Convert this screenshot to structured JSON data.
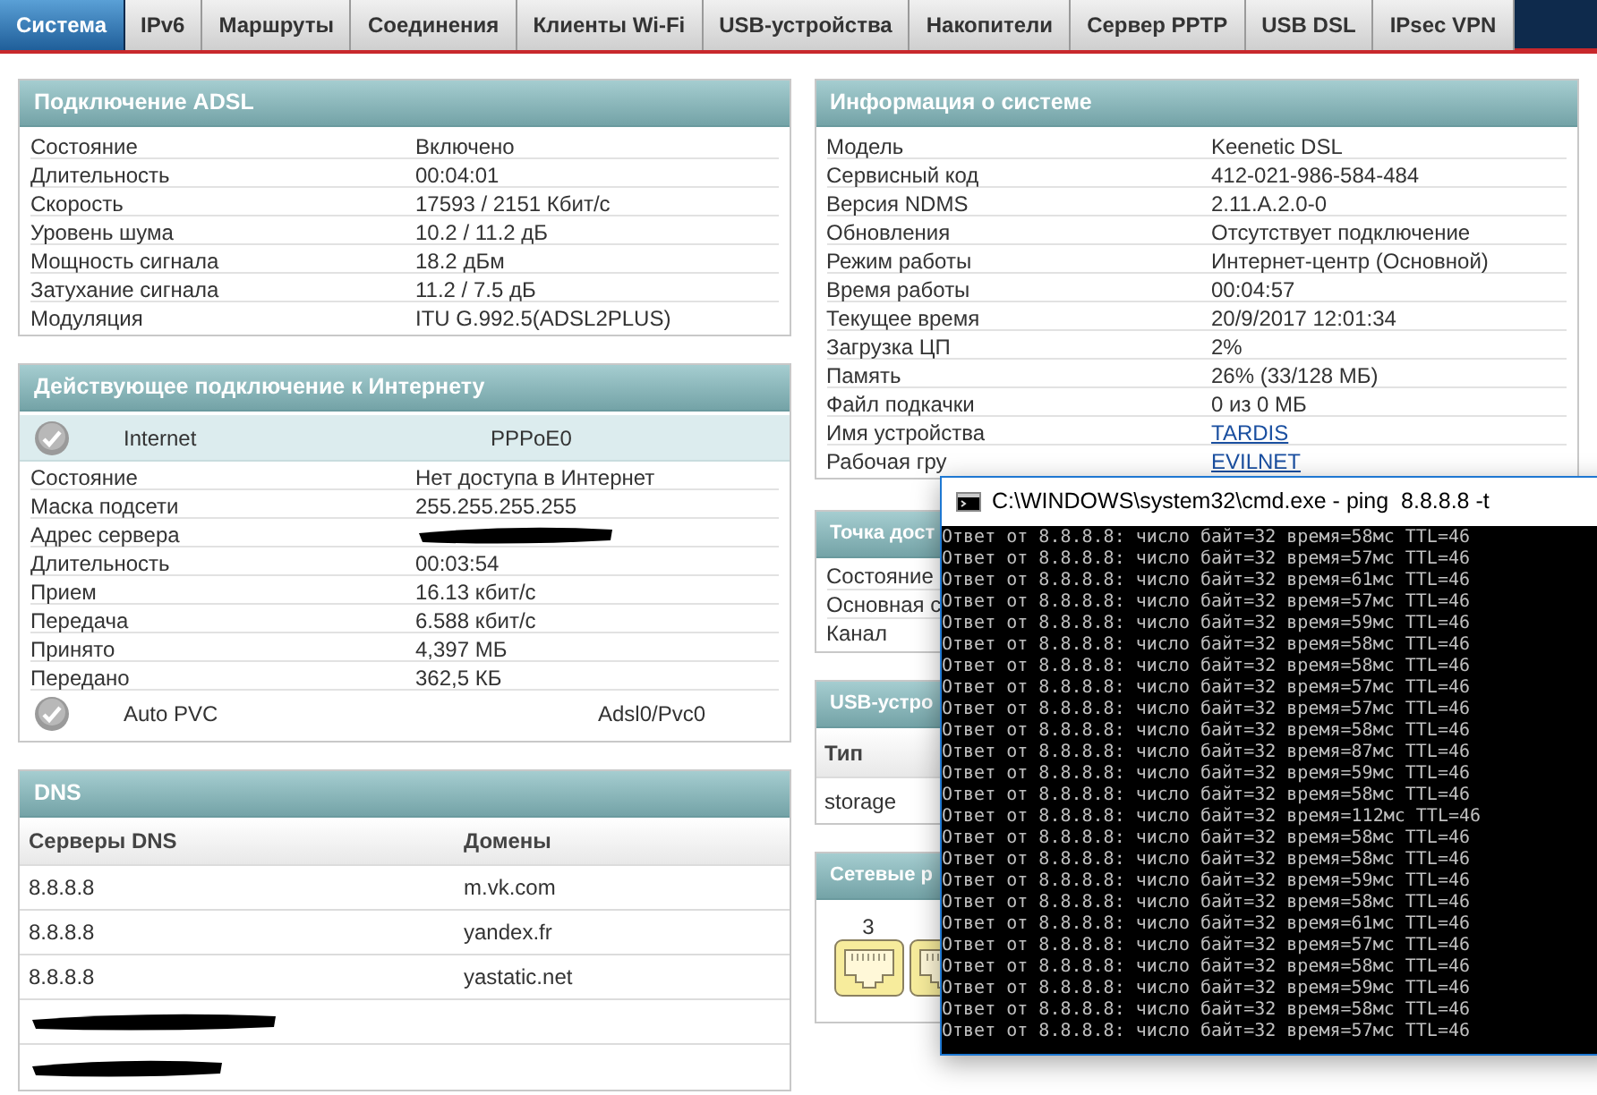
{
  "tabs": [
    {
      "label": "Система",
      "selected": true
    },
    {
      "label": "IPv6",
      "selected": false
    },
    {
      "label": "Маршруты",
      "selected": false
    },
    {
      "label": "Соединения",
      "selected": false
    },
    {
      "label": "Клиенты Wi-Fi",
      "selected": false
    },
    {
      "label": "USB-устройства",
      "selected": false
    },
    {
      "label": "Накопители",
      "selected": false
    },
    {
      "label": "Сервер PPTP",
      "selected": false
    },
    {
      "label": "USB DSL",
      "selected": false
    },
    {
      "label": "IPsec VPN",
      "selected": false
    }
  ],
  "adsl": {
    "title": "Подключение ADSL",
    "rows": [
      {
        "label": "Состояние",
        "value": "Включено"
      },
      {
        "label": "Длительность",
        "value": "00:04:01"
      },
      {
        "label": "Скорость",
        "value": "17593 / 2151 Кбит/с"
      },
      {
        "label": "Уровень шума",
        "value": "10.2 / 11.2 дБ"
      },
      {
        "label": "Мощность сигнала",
        "value": "18.2 дБм"
      },
      {
        "label": "Затухание сигнала",
        "value": "11.2 / 7.5 дБ"
      },
      {
        "label": "Модуляция",
        "value": "ITU G.992.5(ADSL2PLUS)"
      }
    ]
  },
  "internet": {
    "title": "Действующее подключение к Интернету",
    "rows": [
      {
        "kind": "connection",
        "name": "Internet",
        "interface": "PPPoE0",
        "highlighted": true
      },
      {
        "kind": "field",
        "label": "Состояние",
        "value": "Нет доступа в Интернет"
      },
      {
        "kind": "field",
        "label": "Маска подсети",
        "value": "255.255.255.255"
      },
      {
        "kind": "field",
        "label": "Адрес сервера",
        "redacted": true
      },
      {
        "kind": "field",
        "label": "Длительность",
        "value": "00:03:54"
      },
      {
        "kind": "field",
        "label": "Прием",
        "value": "16.13 кбит/с"
      },
      {
        "kind": "field",
        "label": "Передача",
        "value": "6.588 кбит/с"
      },
      {
        "kind": "field",
        "label": "Принято",
        "value": "4,397 МБ"
      },
      {
        "kind": "field",
        "label": "Передано",
        "value": "362,5 КБ"
      },
      {
        "kind": "connection",
        "name": "Auto PVC",
        "interface": "Adsl0/Pvc0",
        "highlighted": false
      }
    ]
  },
  "dns": {
    "title": "DNS",
    "columns": [
      "Серверы DNS",
      "Домены"
    ],
    "rows": [
      {
        "server": "8.8.8.8",
        "domain": "m.vk.com"
      },
      {
        "server": "8.8.8.8",
        "domain": "yandex.fr"
      },
      {
        "server": "8.8.8.8",
        "domain": "yastatic.net"
      },
      {
        "redacted": true
      },
      {
        "redacted": true
      }
    ]
  },
  "system": {
    "title": "Информация о системе",
    "rows": [
      {
        "label": "Модель",
        "value": "Keenetic DSL"
      },
      {
        "label": "Сервисный код",
        "value": "412-021-986-584-484"
      },
      {
        "label": "Версия NDMS",
        "value": "2.11.A.2.0-0"
      },
      {
        "label": "Обновления",
        "value": "Отсутствует подключение"
      },
      {
        "label": "Режим работы",
        "value": "Интернет-центр (Основной)"
      },
      {
        "label": "Время работы",
        "value": "00:04:57"
      },
      {
        "label": "Текущее время",
        "value": "20/9/2017 12:01:34"
      },
      {
        "label": "Загрузка ЦП",
        "value": "2%"
      },
      {
        "label": "Память",
        "value": "26% (33/128 МБ)"
      },
      {
        "label": "Файл подкачки",
        "value": "0 из 0 МБ"
      },
      {
        "label": "Имя устройства",
        "value": "TARDIS",
        "link": true
      },
      {
        "label": "Рабочая гру",
        "value": "EVILNET",
        "link": true
      }
    ]
  },
  "access_point": {
    "title": "Точка дост",
    "rows": [
      "Состояние",
      "Основная с",
      "Канал"
    ]
  },
  "usb": {
    "title": "USB-устро",
    "columns": [
      "Тип"
    ],
    "rows": [
      "storage"
    ]
  },
  "ports": {
    "title": "Сетевые р",
    "items": [
      {
        "kind": "labeled",
        "label": "3"
      },
      {
        "kind": "covered"
      }
    ]
  },
  "console": {
    "title": "C:\\WINDOWS\\system32\\cmd.exe - ping  8.8.8.8 -t",
    "lines": [
      "Ответ от 8.8.8.8: число байт=32 время=58мс TTL=46",
      "Ответ от 8.8.8.8: число байт=32 время=57мс TTL=46",
      "Ответ от 8.8.8.8: число байт=32 время=61мс TTL=46",
      "Ответ от 8.8.8.8: число байт=32 время=57мс TTL=46",
      "Ответ от 8.8.8.8: число байт=32 время=59мс TTL=46",
      "Ответ от 8.8.8.8: число байт=32 время=58мс TTL=46",
      "Ответ от 8.8.8.8: число байт=32 время=58мс TTL=46",
      "Ответ от 8.8.8.8: число байт=32 время=57мс TTL=46",
      "Ответ от 8.8.8.8: число байт=32 время=57мс TTL=46",
      "Ответ от 8.8.8.8: число байт=32 время=58мс TTL=46",
      "Ответ от 8.8.8.8: число байт=32 время=87мс TTL=46",
      "Ответ от 8.8.8.8: число байт=32 время=59мс TTL=46",
      "Ответ от 8.8.8.8: число байт=32 время=58мс TTL=46",
      "Ответ от 8.8.8.8: число байт=32 время=112мс TTL=46",
      "Ответ от 8.8.8.8: число байт=32 время=58мс TTL=46",
      "Ответ от 8.8.8.8: число байт=32 время=58мс TTL=46",
      "Ответ от 8.8.8.8: число байт=32 время=59мс TTL=46",
      "Ответ от 8.8.8.8: число байт=32 время=58мс TTL=46",
      "Ответ от 8.8.8.8: число байт=32 время=61мс TTL=46",
      "Ответ от 8.8.8.8: число байт=32 время=57мс TTL=46",
      "Ответ от 8.8.8.8: число байт=32 время=58мс TTL=46",
      "Ответ от 8.8.8.8: число байт=32 время=59мс TTL=46",
      "Ответ от 8.8.8.8: число байт=32 время=58мс TTL=46",
      "Ответ от 8.8.8.8: число байт=32 время=57мс TTL=46"
    ]
  }
}
